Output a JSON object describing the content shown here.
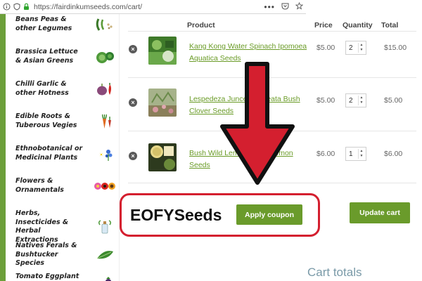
{
  "browser": {
    "url": "https://fairdinkumseeds.com/cart/",
    "icons": [
      "info-icon",
      "shield-icon",
      "lock-icon",
      "more-icon",
      "pocket-icon",
      "bookmark-star-icon"
    ]
  },
  "sidebar": {
    "categories": [
      {
        "label": "Beans Peas & other Legumes",
        "icon": "bean-icon"
      },
      {
        "label": "Brassica Lettuce & Asian Greens",
        "icon": "cabbage-icon"
      },
      {
        "label": "Chilli Garlic & other Hotness",
        "icon": "garlic-chilli-icon"
      },
      {
        "label": "Edible Roots & Tuberous Vegies",
        "icon": "carrot-icon"
      },
      {
        "label": "Ethnobotanical or Medicinal Plants",
        "icon": "medicinal-flower-icon"
      },
      {
        "label": "Flowers & Ornamentals",
        "icon": "flowers-icon"
      },
      {
        "label": "Herbs, Insecticides & Herbal Extractions",
        "icon": "herb-bottle-icon"
      },
      {
        "label": "Natives Ferals & Bushtucker Species",
        "icon": "leaf-icon"
      },
      {
        "label": "Tomato Eggplant &",
        "icon": "eggplant-icon"
      }
    ]
  },
  "cart": {
    "headers": {
      "product": "Product",
      "price": "Price",
      "quantity": "Quantity",
      "total": "Total"
    },
    "items": [
      {
        "name": "Kang Kong Water Spinach Ipomoea Aquatica Seeds",
        "price": "$5.00",
        "qty": "2",
        "total": "$15.00"
      },
      {
        "name": "Lespedeza Juncea Cuneata Bush Clover Seeds",
        "price": "$5.00",
        "qty": "2",
        "total": "$5.00"
      },
      {
        "name": "Bush Wild Lemon Citrus Lemon Seeds",
        "price": "$6.00",
        "qty": "1",
        "total": "$6.00"
      }
    ],
    "remove_symbol": "×"
  },
  "coupon": {
    "code": "EOFYSeeds",
    "apply_label": "Apply coupon"
  },
  "update_label": "Update cart",
  "cart_totals_heading": "Cart totals",
  "colors": {
    "accent_green": "#6a9b2b",
    "link_green": "#6a9b27",
    "highlight_red": "#d41f2f"
  }
}
